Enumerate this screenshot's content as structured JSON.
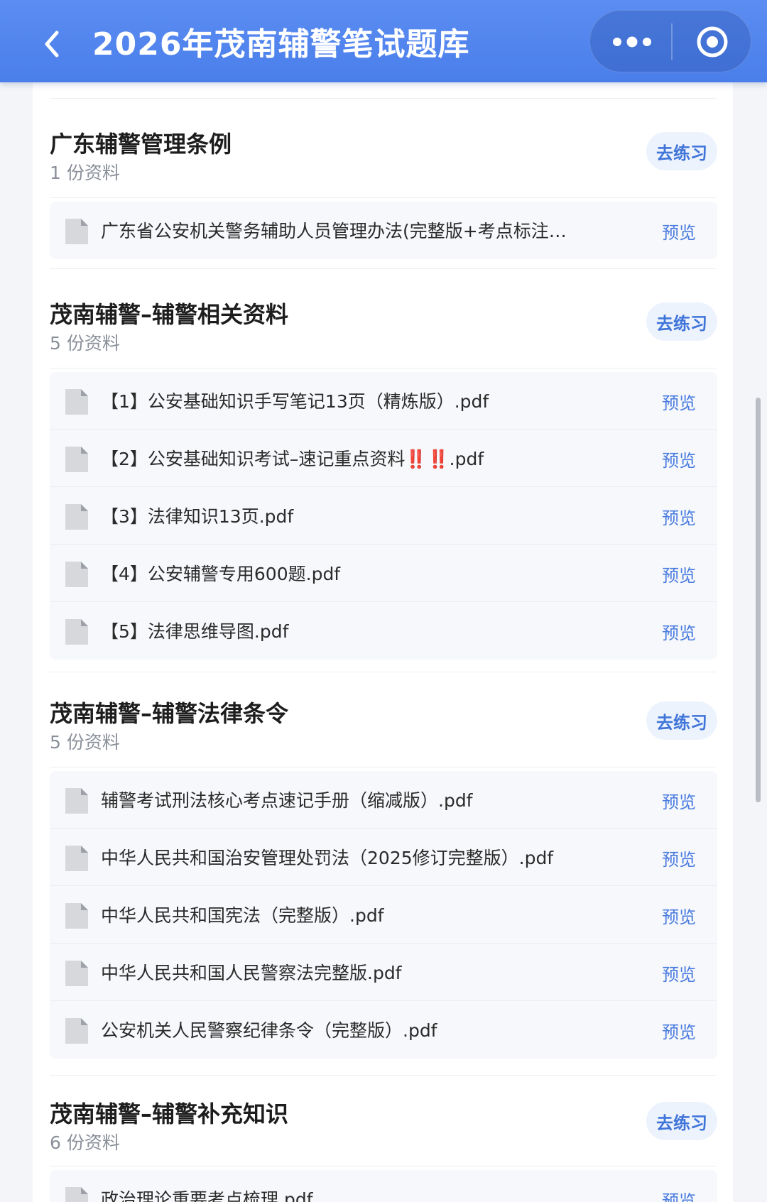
{
  "header": {
    "title": "2026年茂南辅警笔试题库"
  },
  "icons": {
    "back": "chevron-left-icon",
    "more": "more-dots-icon",
    "close": "close-target-icon",
    "file": "document-icon"
  },
  "colors": {
    "header_bg": "#5b8df2",
    "accent": "#3f74d9",
    "button_bg": "#edf3fd"
  },
  "sections": [
    {
      "title": "广东辅警管理条例",
      "count": "1 份资料",
      "practice": "去练习",
      "files": [
        {
          "name": "广东省公安机关警务辅助人员管理办法(完整版+考点标注+考…",
          "action": "预览"
        }
      ]
    },
    {
      "title": "茂南辅警–辅警相关资料",
      "count": "5 份资料",
      "practice": "去练习",
      "files": [
        {
          "name": "【1】公安基础知识手写笔记13页（精炼版）.pdf",
          "action": "预览"
        },
        {
          "name": "【2】公安基础知识考试–速记重点资料‼️‼️.pdf",
          "action": "预览"
        },
        {
          "name": "【3】法律知识13页.pdf",
          "action": "预览"
        },
        {
          "name": "【4】公安辅警专用600题.pdf",
          "action": "预览"
        },
        {
          "name": "【5】法律思维导图.pdf",
          "action": "预览"
        }
      ]
    },
    {
      "title": "茂南辅警–辅警法律条令",
      "count": "5 份资料",
      "practice": "去练习",
      "files": [
        {
          "name": "辅警考试刑法核心考点速记手册（缩减版）.pdf",
          "action": "预览"
        },
        {
          "name": "中华人民共和国治安管理处罚法（2025修订完整版）.pdf",
          "action": "预览"
        },
        {
          "name": "中华人民共和国宪法（完整版）.pdf",
          "action": "预览"
        },
        {
          "name": "中华人民共和国人民警察法完整版.pdf",
          "action": "预览"
        },
        {
          "name": "公安机关人民警察纪律条令（完整版）.pdf",
          "action": "预览"
        }
      ]
    },
    {
      "title": "茂南辅警–辅警补充知识",
      "count": "6 份资料",
      "practice": "去练习",
      "files": [
        {
          "name": "政治理论重要考点梳理.pdf",
          "action": "预览"
        }
      ]
    }
  ]
}
